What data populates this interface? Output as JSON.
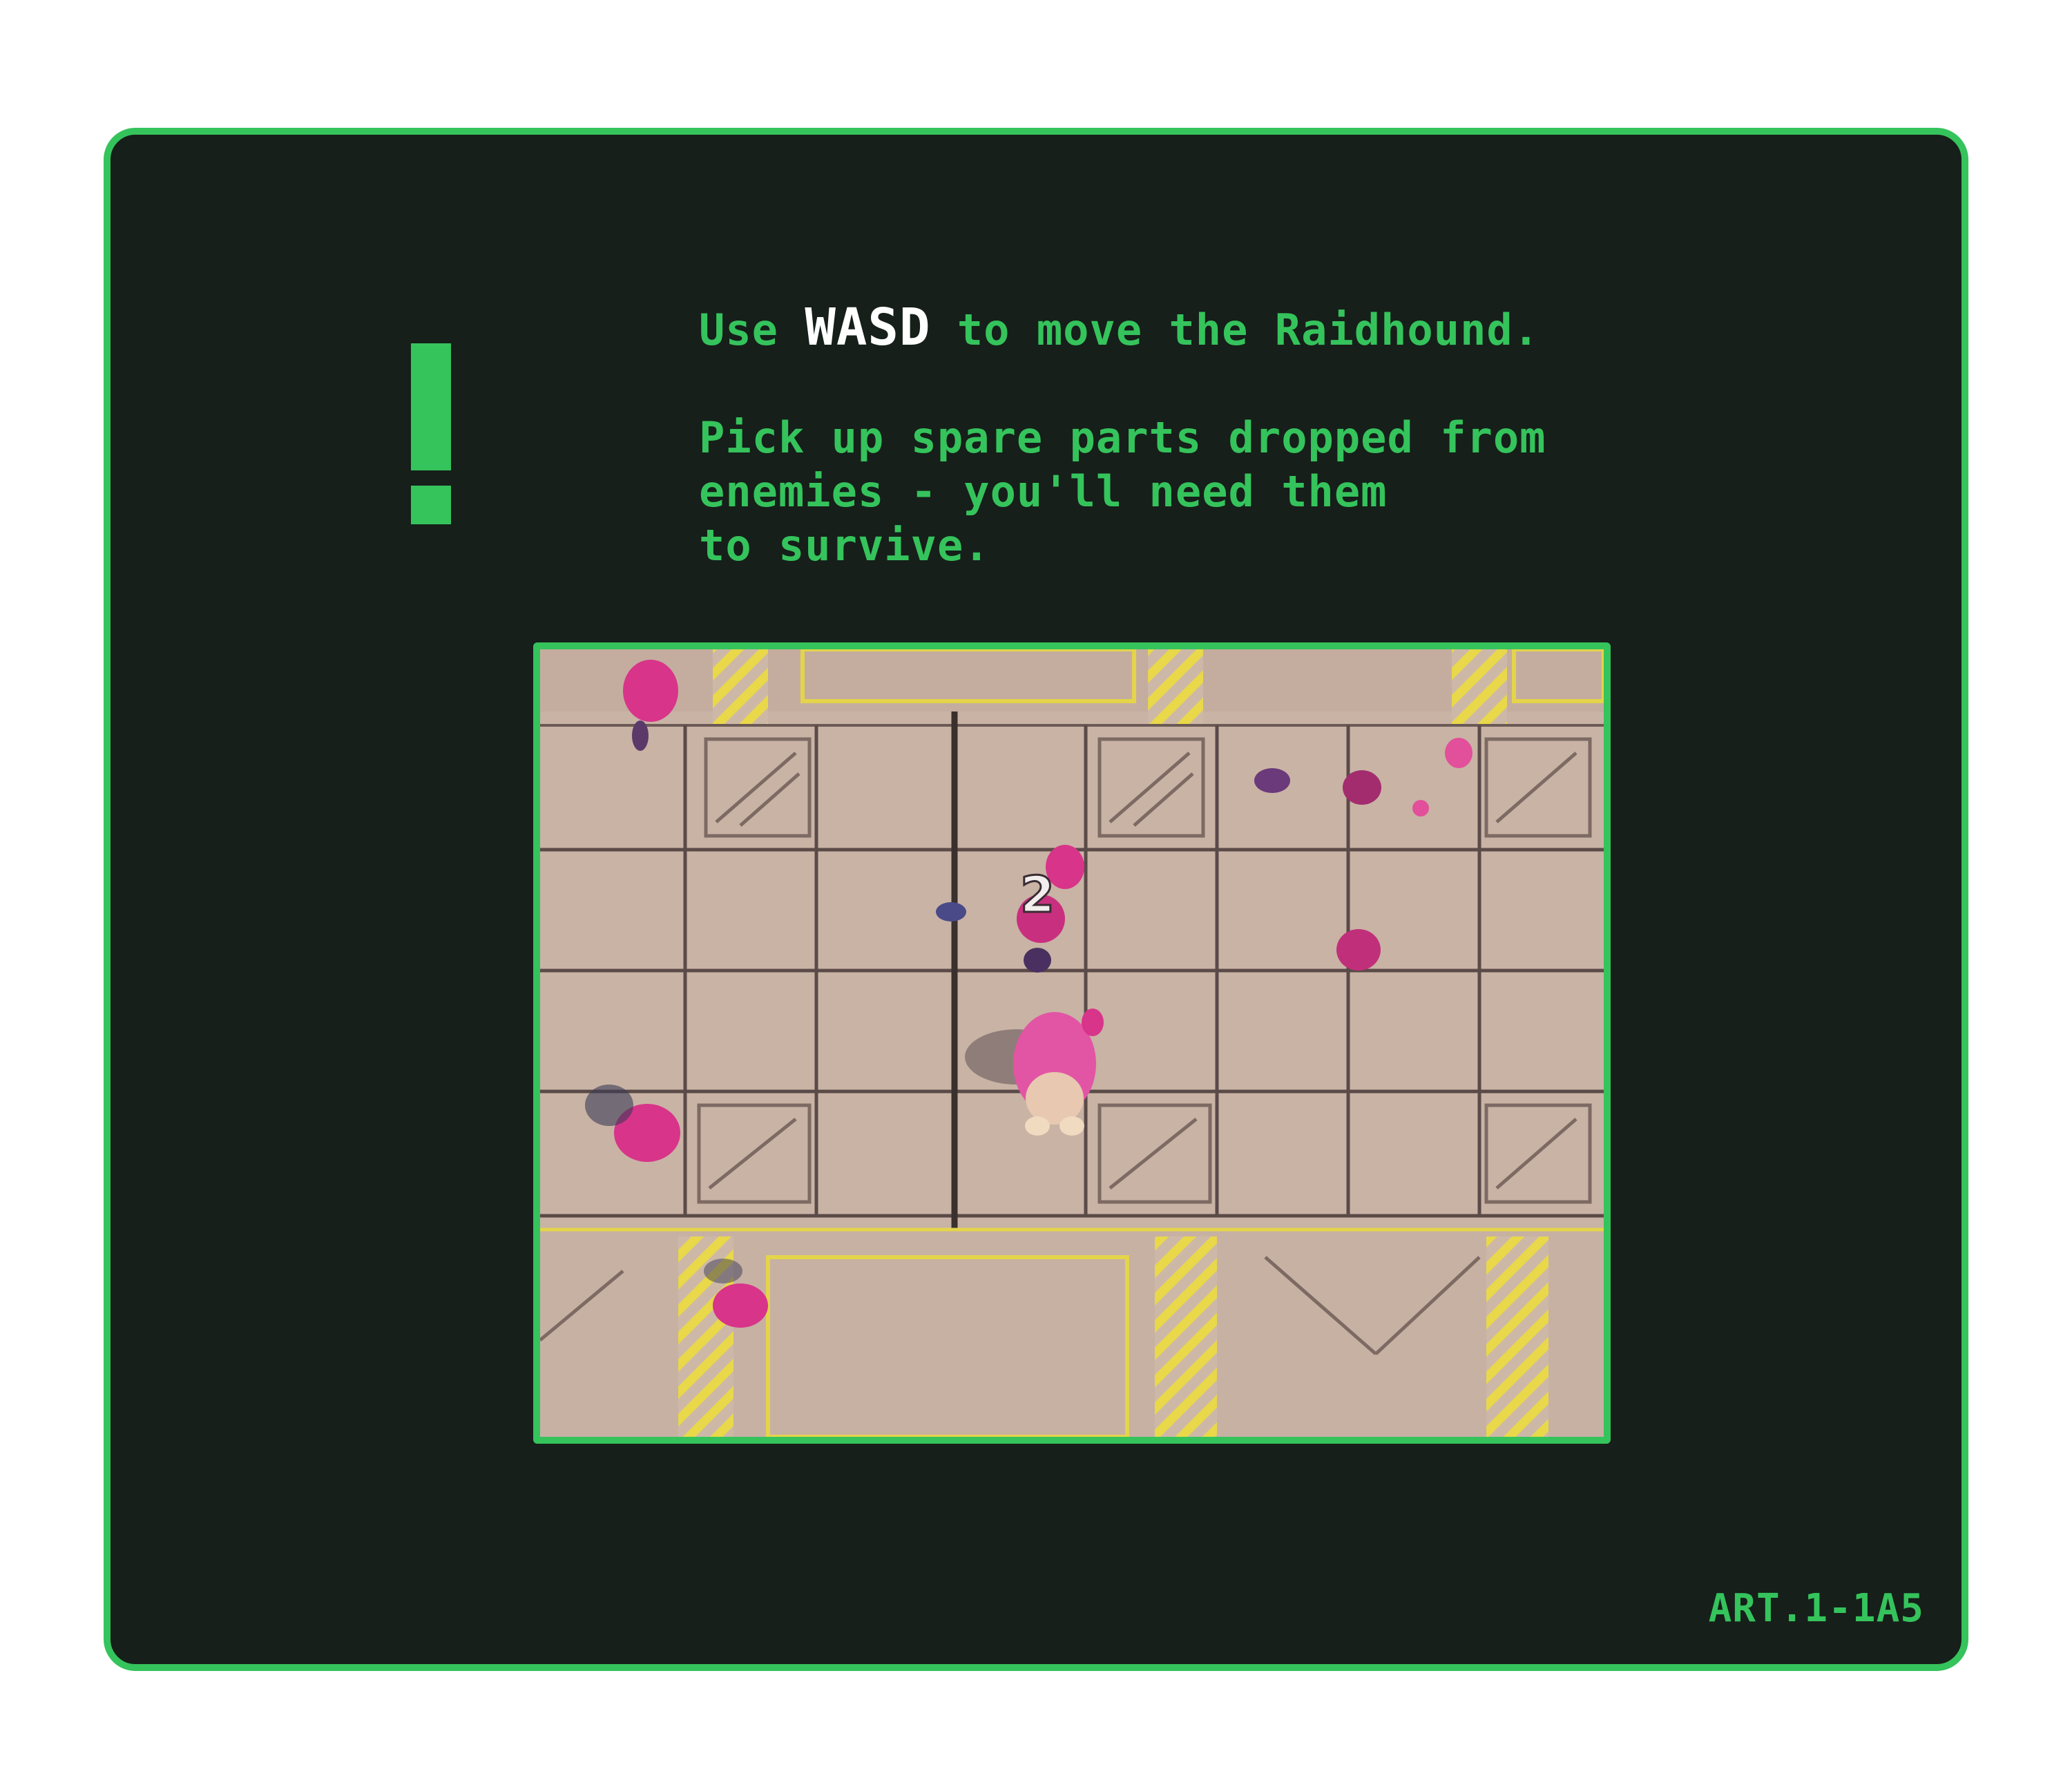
{
  "tutorial": {
    "line1_prefix": "Use",
    "line1_key": "WASD",
    "line1_suffix": "to move the Raidhound.",
    "line2": "Pick up spare parts dropped from",
    "line3": "enemies - you'll need them",
    "line4": "to survive."
  },
  "alert": {
    "icon": "exclamation-icon"
  },
  "gameplay": {
    "combo_counter": "2"
  },
  "footer": {
    "code": "ART.1-1A5"
  },
  "colors": {
    "accent": "#35c35c",
    "panel_bg": "#161f1a",
    "key_text": "#ffffff",
    "floor": "#c9b3a5",
    "hazard_stripe": "#e8d84a",
    "enemy": "#d8348a"
  }
}
